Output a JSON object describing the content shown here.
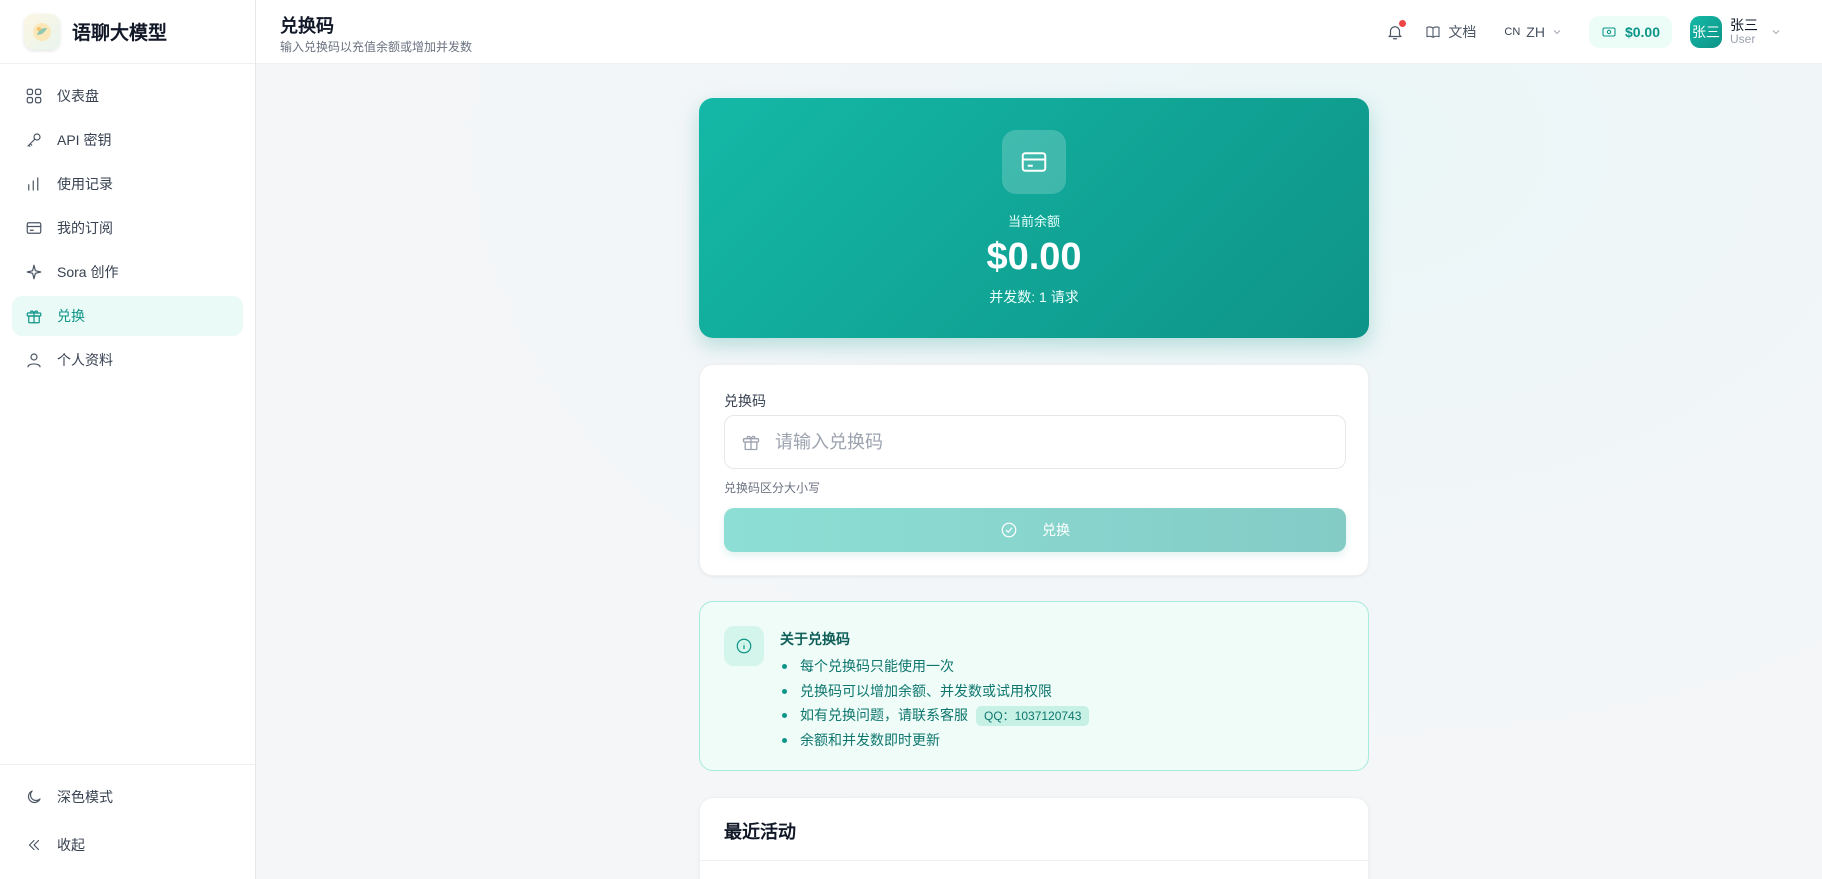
{
  "brand": {
    "name": "语聊大模型"
  },
  "sidebar": {
    "items": [
      {
        "label": "仪表盘",
        "icon": "grid-icon"
      },
      {
        "label": "API 密钥",
        "icon": "key-icon"
      },
      {
        "label": "使用记录",
        "icon": "bar-chart-icon"
      },
      {
        "label": "我的订阅",
        "icon": "card-icon"
      },
      {
        "label": "Sora 创作",
        "icon": "sparkle-icon"
      },
      {
        "label": "兑换",
        "icon": "gift-icon",
        "active": true
      },
      {
        "label": "个人资料",
        "icon": "user-icon"
      }
    ],
    "bottom": {
      "dark_mode": "深色模式",
      "collapse": "收起"
    }
  },
  "header": {
    "title": "兑换码",
    "subtitle": "输入兑换码以充值余额或增加并发数",
    "docs": "文档",
    "lang_flag": "CN",
    "lang": "ZH",
    "balance": "$0.00",
    "user": {
      "avatar": "张三",
      "name": "张三",
      "role": "User"
    }
  },
  "hero": {
    "label": "当前余额",
    "amount": "$0.00",
    "concurrency": "并发数: 1 请求"
  },
  "redeem": {
    "field_label": "兑换码",
    "placeholder": "请输入兑换码",
    "hint": "兑换码区分大小写",
    "button": "兑换"
  },
  "info": {
    "title": "关于兑换码",
    "items": [
      "每个兑换码只能使用一次",
      "兑换码可以增加余额、并发数或试用权限",
      "如有兑换问题，请联系客服",
      "余额和并发数即时更新"
    ],
    "qq": "QQ：1037120743"
  },
  "activity": {
    "title": "最近活动"
  },
  "colors": {
    "accent": "#0d9488",
    "accent_light": "#14b8a6",
    "notice_dot": "#ef4444"
  }
}
